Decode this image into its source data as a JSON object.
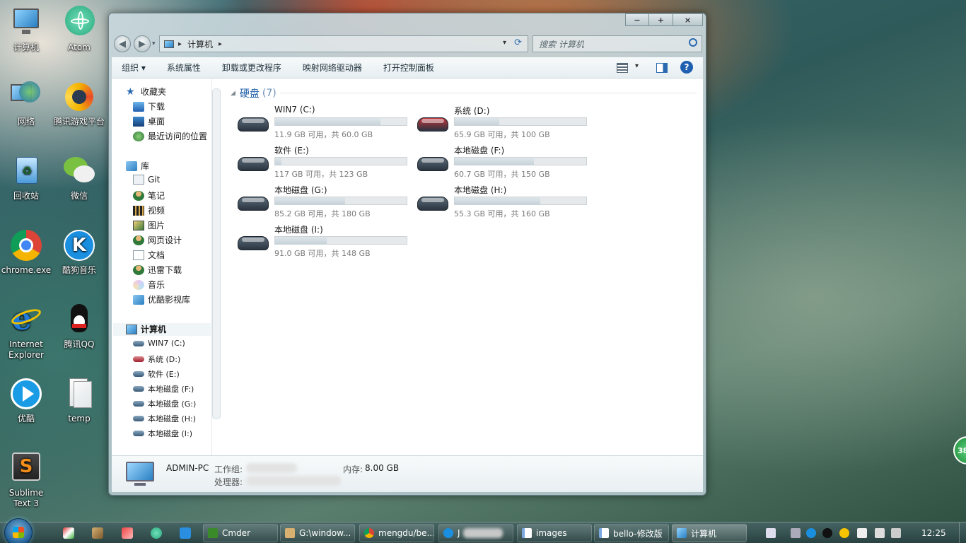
{
  "desktop": {
    "icons": [
      {
        "label": "计算机"
      },
      {
        "label": "Atom"
      },
      {
        "label": "网络"
      },
      {
        "label": "腾讯游戏平台"
      },
      {
        "label": "回收站"
      },
      {
        "label": "微信"
      },
      {
        "label": "chrome.exe"
      },
      {
        "label": "酷狗音乐"
      },
      {
        "label": "Internet Explorer"
      },
      {
        "label": "腾讯QQ"
      },
      {
        "label": "优酷"
      },
      {
        "label": "temp"
      },
      {
        "label": "Sublime Text 3"
      }
    ],
    "badge": "38"
  },
  "window": {
    "controls": {
      "minimize": "−",
      "maximize": "+",
      "close": "×"
    },
    "nav": {
      "back": "◀",
      "forward": "▶"
    },
    "address": {
      "crumb": "计算机",
      "sep": "▸"
    },
    "search": {
      "placeholder": "搜索 计算机"
    },
    "toolbar": {
      "organize": "组织 ▾",
      "properties": "系统属性",
      "uninstall": "卸载或更改程序",
      "map_drive": "映射网络驱动器",
      "control_panel": "打开控制面板"
    },
    "nav_pane": {
      "favorites": "收藏夹",
      "fav_items": [
        "下载",
        "桌面",
        "最近访问的位置"
      ],
      "libraries": "库",
      "lib_items": [
        "Git",
        "笔记",
        "视频",
        "图片",
        "网页设计",
        "文档",
        "迅雷下载",
        "音乐",
        "优酷影视库"
      ],
      "computer": "计算机",
      "drives": [
        "WIN7 (C:)",
        "系统 (D:)",
        "软件 (E:)",
        "本地磁盘 (F:)",
        "本地磁盘 (G:)",
        "本地磁盘 (H:)",
        "本地磁盘 (I:)"
      ]
    },
    "group": {
      "title": "硬盘",
      "count": "(7)"
    },
    "drives": [
      {
        "name": "WIN7 (C:)",
        "info": "11.9 GB 可用，共 60.0 GB",
        "used_fraction": 0.8,
        "color": "#5a6a78"
      },
      {
        "name": "系统 (D:)",
        "info": "65.9 GB 可用，共 100 GB",
        "used_fraction": 0.34,
        "color": "#c0333a"
      },
      {
        "name": "软件 (E:)",
        "info": "117 GB 可用，共 123 GB",
        "used_fraction": 0.05,
        "color": "#5a6a78"
      },
      {
        "name": "本地磁盘 (F:)",
        "info": "60.7 GB 可用，共 150 GB",
        "used_fraction": 0.6,
        "color": "#5a6a78"
      },
      {
        "name": "本地磁盘 (G:)",
        "info": "85.2 GB 可用，共 180 GB",
        "used_fraction": 0.53,
        "color": "#5a6a78"
      },
      {
        "name": "本地磁盘 (H:)",
        "info": "55.3 GB 可用，共 160 GB",
        "used_fraction": 0.65,
        "color": "#5a6a78"
      },
      {
        "name": "本地磁盘 (I:)",
        "info": "91.0 GB 可用，共 148 GB",
        "used_fraction": 0.39,
        "color": "#5a6a78"
      }
    ],
    "details": {
      "pc_name": "ADMIN-PC",
      "workgroup_label": "工作组:",
      "processor_label": "处理器:",
      "memory_label": "内存:",
      "memory_value": "8.00 GB"
    }
  },
  "taskbar": {
    "tasks": [
      "Cmder",
      "G:\\window...",
      "mengdu/be...",
      "J",
      "images",
      "bello-修改版",
      "计算机"
    ],
    "clock": "12:25"
  }
}
